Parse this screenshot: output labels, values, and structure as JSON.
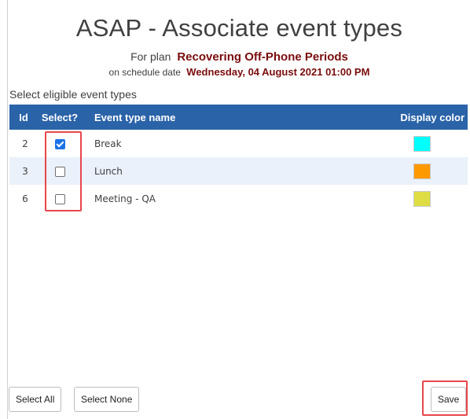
{
  "header": {
    "title": "ASAP - Associate event types",
    "plan_prefix": "For plan",
    "plan_name": "Recovering Off-Phone Periods",
    "date_prefix": "on schedule date",
    "schedule_date": "Wednesday, 04 August 2021 01:00 PM"
  },
  "section_label": "Select eligible event types",
  "grid": {
    "columns": {
      "id": "Id",
      "select": "Select?",
      "name": "Event type name",
      "color": "Display color"
    },
    "rows": [
      {
        "id": "2",
        "selected": true,
        "name": "Break",
        "color": "#00ffff"
      },
      {
        "id": "3",
        "selected": false,
        "name": "Lunch",
        "color": "#ff9900"
      },
      {
        "id": "6",
        "selected": false,
        "name": "Meeting - QA",
        "color": "#dede44"
      }
    ]
  },
  "buttons": {
    "select_all": "Select All",
    "select_none": "Select None",
    "save": "Save"
  },
  "colors": {
    "header_bg": "#2a63a8",
    "accent_text": "#7a0c0c",
    "highlight": "#e8474c"
  }
}
